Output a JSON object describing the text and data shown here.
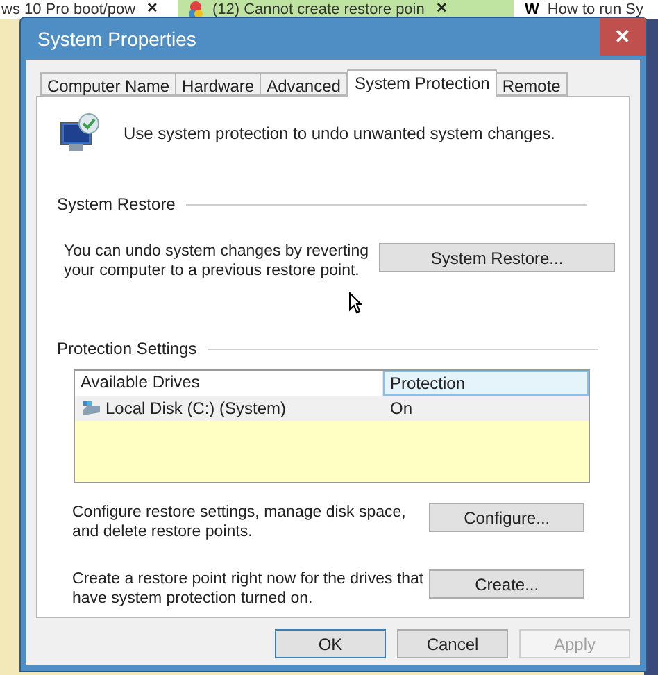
{
  "browser_tabs": [
    {
      "title": "ws 10 Pro boot/pow",
      "close": "✕",
      "selected": false
    },
    {
      "title": "(12) Cannot create restore poin",
      "close": "✕",
      "selected": true
    },
    {
      "title": "How to run Sy",
      "logo": "W",
      "selected": false
    }
  ],
  "window": {
    "title": "System Properties",
    "close": "✕"
  },
  "tabs": [
    {
      "label": "Computer Name",
      "selected": false
    },
    {
      "label": "Hardware",
      "selected": false
    },
    {
      "label": "Advanced",
      "selected": false
    },
    {
      "label": "System Protection",
      "selected": true
    },
    {
      "label": "Remote",
      "selected": false
    }
  ],
  "intro": "Use system protection to undo unwanted system changes.",
  "system_restore": {
    "heading": "System Restore",
    "description": "You can undo system changes by reverting your computer to a previous restore point.",
    "button": "System Restore..."
  },
  "protection_settings": {
    "heading": "Protection Settings",
    "columns": [
      {
        "label": "Available Drives",
        "selected": false
      },
      {
        "label": "Protection",
        "selected": true
      }
    ],
    "rows": [
      {
        "drive": "Local Disk (C:) (System)",
        "protection": "On"
      }
    ],
    "actions": [
      {
        "description": "Configure restore settings, manage disk space, and delete restore points.",
        "button": "Configure..."
      },
      {
        "description": "Create a restore point right now for the drives that have system protection turned on.",
        "button": "Create..."
      }
    ]
  },
  "buttons": [
    {
      "label": "OK",
      "disabled": false,
      "default": true
    },
    {
      "label": "Cancel",
      "disabled": false,
      "default": false
    },
    {
      "label": "Apply",
      "disabled": true,
      "default": false
    }
  ]
}
